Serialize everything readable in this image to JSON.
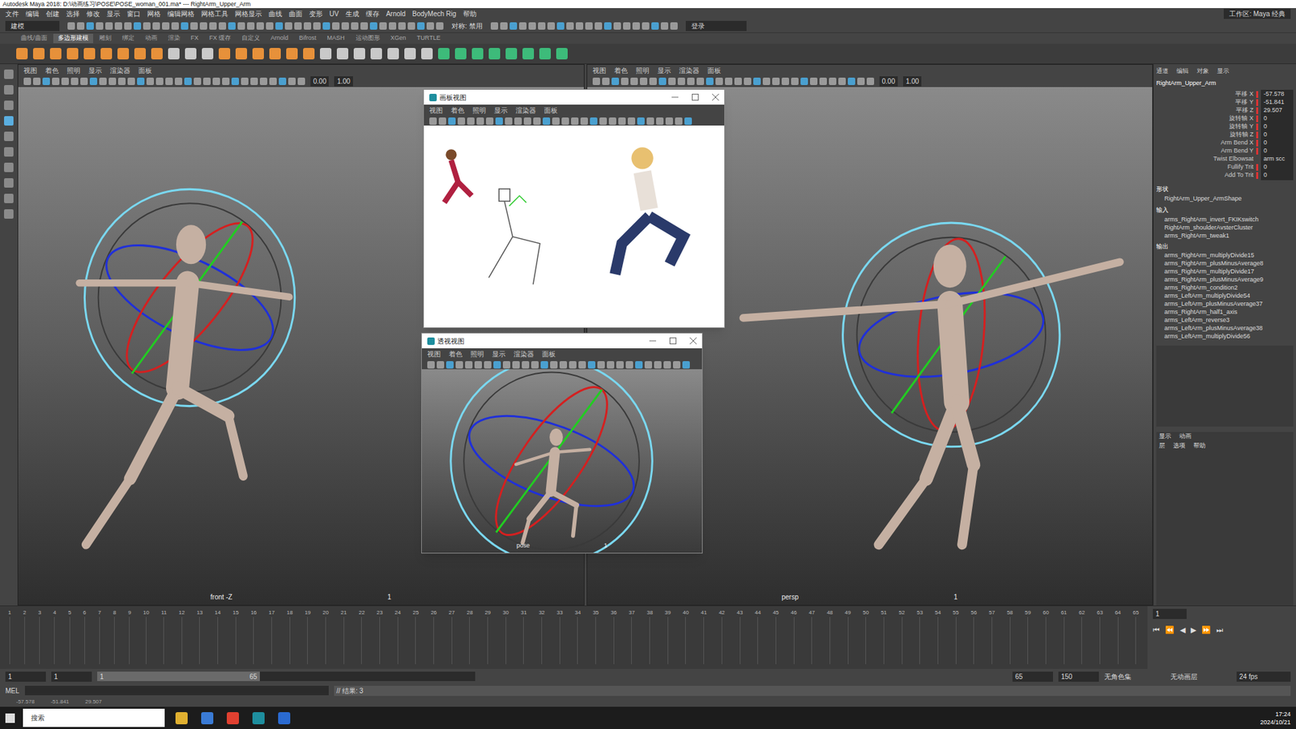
{
  "window": {
    "title": "Autodesk Maya 2018: D:\\动画练习\\POSE\\POSE_woman_001.ma* --- RightArm_Upper_Arm",
    "workspace": "工作区: Maya 经典"
  },
  "menu": [
    "文件",
    "编辑",
    "创建",
    "选择",
    "修改",
    "显示",
    "窗口",
    "网格",
    "编辑网格",
    "网格工具",
    "网格显示",
    "曲线",
    "曲面",
    "变形",
    "UV",
    "生成",
    "缓存",
    "Arnold",
    "BodyMech Rig",
    "帮助"
  ],
  "status_line": {
    "mode": "建模",
    "symmetry": "对称: 禁用",
    "login": "登录"
  },
  "shelf": {
    "tabs": [
      {
        "label": "曲线/曲面",
        "selected": false
      },
      {
        "label": "多边形建模",
        "selected": true
      },
      {
        "label": "雕刻",
        "selected": false
      },
      {
        "label": "绑定",
        "selected": false
      },
      {
        "label": "动画",
        "selected": false
      },
      {
        "label": "渲染",
        "selected": false
      },
      {
        "label": "FX",
        "selected": false
      },
      {
        "label": "FX 缓存",
        "selected": false
      },
      {
        "label": "自定义",
        "selected": false
      },
      {
        "label": "Arnold",
        "selected": false
      },
      {
        "label": "Bifrost",
        "selected": false
      },
      {
        "label": "MASH",
        "selected": false
      },
      {
        "label": "运动图形",
        "selected": false
      },
      {
        "label": "XGen",
        "selected": false
      },
      {
        "label": "TURTLE",
        "selected": false
      }
    ]
  },
  "viewports": [
    {
      "label": "front -Z",
      "menu": [
        "视图",
        "着色",
        "照明",
        "显示",
        "渲染器",
        "面板"
      ],
      "value_a": "0.00",
      "value_b": "1.00",
      "frame": "1"
    },
    {
      "label": "persp",
      "menu": [
        "视图",
        "着色",
        "照明",
        "显示",
        "渲染器",
        "面板"
      ],
      "value_a": "0.00",
      "value_b": "1.00",
      "frame": "1"
    }
  ],
  "floating_windows": [
    {
      "title": "画板视图",
      "menu": [
        "视图",
        "着色",
        "照明",
        "显示",
        "渲染器",
        "面板"
      ]
    },
    {
      "title": "透视视图",
      "menu": [
        "视图",
        "着色",
        "照明",
        "显示",
        "渲染器",
        "面板"
      ],
      "label": "pose",
      "frame": "1"
    }
  ],
  "channel_box": {
    "tabs": [
      "通道",
      "编辑",
      "对象",
      "显示"
    ],
    "object": "RightArm_Upper_Arm",
    "attributes": [
      {
        "name": "平移 X",
        "value": "-57.578",
        "keyed": true
      },
      {
        "name": "平移 Y",
        "value": "-51.841",
        "keyed": true
      },
      {
        "name": "平移 Z",
        "value": "29.507",
        "keyed": true
      },
      {
        "name": "旋转轴 X",
        "value": "0",
        "keyed": true
      },
      {
        "name": "旋转轴 Y",
        "value": "0",
        "keyed": true
      },
      {
        "name": "旋转轴 Z",
        "value": "0",
        "keyed": true
      },
      {
        "name": "Arm Bend X",
        "value": "0",
        "keyed": true
      },
      {
        "name": "Arm Bend Y",
        "value": "0",
        "keyed": true
      },
      {
        "name": "Twist Elbowsat",
        "value": "arm scc",
        "keyed": false
      },
      {
        "name": "Fullify Trit",
        "value": "0",
        "keyed": true
      },
      {
        "name": "Add To Trit",
        "value": "0",
        "keyed": true
      }
    ],
    "shape_header": "形状",
    "shape": "RightArm_Upper_ArmShape",
    "inputs_header": "输入",
    "inputs": [
      "arms_RightArm_invert_FKIKswitch",
      "RightArm_shoulderAvsterCluster",
      "arms_RightArm_tweak1"
    ],
    "outputs_header": "输出",
    "outputs": [
      "arms_RightArm_multiplyDivide15",
      "arms_RightArm_plusMinusAverage8",
      "arms_RightArm_multiplyDivide17",
      "arms_RightArm_plusMinusAverage9",
      "arms_RightArm_condition2",
      "arms_LeftArm_multiplyDivide54",
      "arms_LeftArm_plusMinusAverage37",
      "arms_RightArm_half1_axis",
      "arms_LeftArm_reverse3",
      "arms_LeftArm_plusMinusAverage38",
      "arms_LeftArm_multiplyDivide56"
    ],
    "layer_tabs": [
      "显示",
      "动画"
    ],
    "layer_menu": [
      "层",
      "选项",
      "帮助"
    ]
  },
  "timeline": {
    "ticks": [
      "1",
      "2",
      "3",
      "4",
      "5",
      "6",
      "7",
      "8",
      "9",
      "10",
      "11",
      "12",
      "13",
      "14",
      "15",
      "16",
      "17",
      "18",
      "19",
      "20",
      "21",
      "22",
      "23",
      "24",
      "25",
      "26",
      "27",
      "28",
      "29",
      "30",
      "31",
      "32",
      "33",
      "34",
      "35",
      "36",
      "37",
      "38",
      "39",
      "40",
      "41",
      "42",
      "43",
      "44",
      "45",
      "46",
      "47",
      "48",
      "49",
      "50",
      "51",
      "52",
      "53",
      "54",
      "55",
      "56",
      "57",
      "58",
      "59",
      "60",
      "61",
      "62",
      "63",
      "64",
      "65"
    ],
    "current": "1",
    "controls": [
      "⏮",
      "⏪",
      "◀",
      "▶",
      "⏩",
      "⏭"
    ]
  },
  "range": {
    "start": "1",
    "inner_start": "1",
    "slider_start": "1",
    "slider_end": "65",
    "inner_end": "65",
    "end": "150",
    "character_set": "无角色集",
    "anim_layer": "无动画层",
    "fps": "24 fps",
    "level": 0.43
  },
  "command_line": {
    "lang": "MEL",
    "result": "// 结果: 3"
  },
  "help_line": [
    "-57.578",
    "-51.841",
    "29.507"
  ],
  "taskbar": {
    "search": "搜索",
    "time": "17:24",
    "date": "2024/10/21"
  }
}
